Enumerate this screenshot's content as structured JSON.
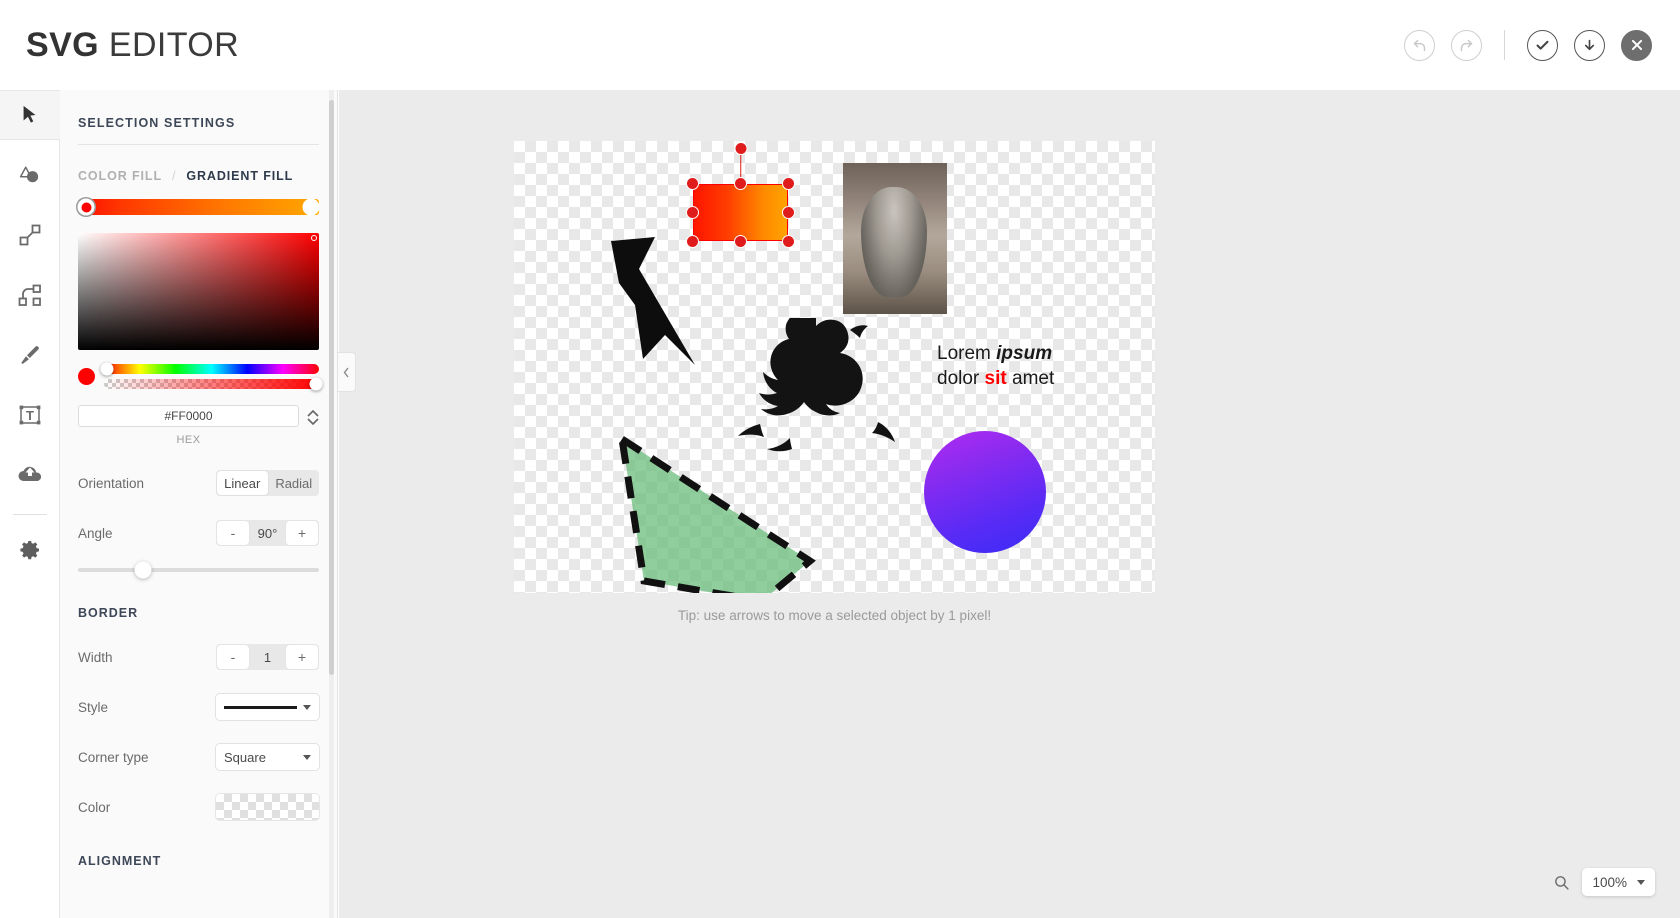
{
  "app": {
    "title_bold": "SVG",
    "title_rest": " EDITOR"
  },
  "topbar": {
    "undo_label": "undo-icon",
    "redo_label": "redo-icon",
    "confirm_label": "check-icon",
    "download_label": "download-icon",
    "close_label": "close-icon"
  },
  "toolbar": {
    "items": [
      {
        "name": "select-tool",
        "icon": "cursor-icon",
        "active": true
      },
      {
        "name": "shape-tool",
        "icon": "shapes-icon",
        "active": false
      },
      {
        "name": "line-tool",
        "icon": "line-icon",
        "active": false
      },
      {
        "name": "path-tool",
        "icon": "bezier-path-icon",
        "active": false
      },
      {
        "name": "brush-tool",
        "icon": "brush-icon",
        "active": false
      },
      {
        "name": "text-tool",
        "icon": "text-icon",
        "active": false
      },
      {
        "name": "upload-tool",
        "icon": "cloud-upload-icon",
        "active": false
      },
      {
        "name": "settings-tool",
        "icon": "gear-icon",
        "active": false
      }
    ]
  },
  "panel": {
    "title": "SELECTION SETTINGS",
    "fill_tabs": {
      "color_fill": "COLOR FILL",
      "separator": "/",
      "gradient_fill": "GRADIENT FILL",
      "active": "GRADIENT FILL"
    },
    "gradient": {
      "start_color": "#FF0000",
      "end_color": "#FFA800"
    },
    "hex": {
      "value": "#FF0000",
      "label": "HEX"
    },
    "orientation": {
      "label": "Orientation",
      "options": [
        "Linear",
        "Radial"
      ],
      "selected": "Linear"
    },
    "angle": {
      "label": "Angle",
      "minus": "-",
      "value": "90°",
      "plus": "+",
      "slider_percent": 27
    },
    "border": {
      "title": "BORDER",
      "width": {
        "label": "Width",
        "minus": "-",
        "value": "1",
        "plus": "+"
      },
      "style": {
        "label": "Style",
        "value": "solid-line"
      },
      "corner": {
        "label": "Corner type",
        "value": "Square"
      },
      "color": {
        "label": "Color",
        "value": "transparent"
      }
    },
    "alignment": {
      "title": "ALIGNMENT"
    },
    "collapse_icon": "chevron-left-icon"
  },
  "canvas": {
    "tip": "Tip: use arrows to move a selected object by 1 pixel!",
    "objects": {
      "selected_rect": {
        "name": "gradient-rectangle",
        "fill": "linear-gradient red to orange"
      },
      "arrow": {
        "name": "black-arrow-shape"
      },
      "kitten_image": {
        "name": "kitten-photo"
      },
      "dragon": {
        "name": "dragon-illustration"
      },
      "green_triangle": {
        "name": "green-dashed-triangle"
      },
      "circle": {
        "name": "purple-gradient-circle"
      },
      "text": {
        "name": "lorem-text",
        "line1_a": "Lorem ",
        "line1_em": "ipsum",
        "line2_a": "dolor ",
        "line2_red": "sit",
        "line2_b": " amet"
      }
    }
  },
  "zoom_control": {
    "icon": "magnifier-icon",
    "value": "100%",
    "caret": "chevron-down-icon"
  }
}
